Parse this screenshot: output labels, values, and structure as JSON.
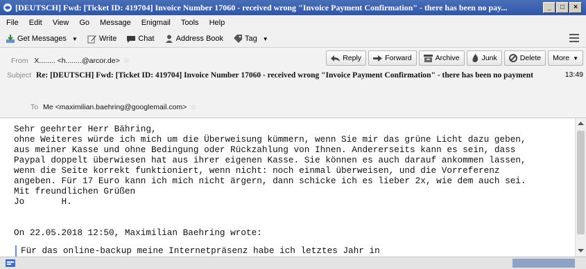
{
  "window": {
    "title": "[DEUTSCH] Fwd: [Ticket ID: 419704] Invoice Number 17060 - received wrong \"Invoice Payment Confirmation\" - there has been no pay...",
    "buttons": [
      "_",
      "□",
      "×"
    ]
  },
  "menu": {
    "items": [
      "File",
      "Edit",
      "View",
      "Go",
      "Message",
      "Enigmail",
      "Tools",
      "Help"
    ]
  },
  "toolbar": {
    "get_messages": "Get Messages",
    "write": "Write",
    "chat": "Chat",
    "address_book": "Address Book",
    "tag": "Tag"
  },
  "header": {
    "from_label": "From",
    "from_value": "X........ <h........@arcor.de>",
    "subject_label": "Subject",
    "subject_value": "Re: [DEUTSCH] Fwd: [Ticket ID: 419704] Invoice Number 17060 - received wrong \"Invoice Payment Confirmation\" - there has been no payment",
    "time": "13:49",
    "to_label": "To",
    "to_value": "Me <maximilian.baehring@googlemail.com>",
    "actions": {
      "reply": "Reply",
      "forward": "Forward",
      "archive": "Archive",
      "junk": "Junk",
      "delete": "Delete",
      "more": "More"
    }
  },
  "body": {
    "lines": [
      "Sehr geehrter Herr Bähring,",
      "ohne Weiteres würde ich mich um die Überweisung kümmern, wenn Sie mir das grüne Licht dazu geben,",
      "aus meiner Kasse und ohne Bedingung oder Rückzahlung von Ihnen. Andererseits kann es sein, dass",
      "Paypal doppelt überwiesen hat aus ihrer eigenen Kasse. Sie können es auch darauf ankommen lassen,",
      "wenn die Seite korrekt funktioniert, wenn nicht: noch einmal überweisen, und die Vorreferenz",
      "angeben. Für 17 Euro kann ich mich nicht ärgern, dann schicke ich es lieber 2x, wie dem auch sei.",
      "Mit freundlichen Grüßen",
      "Jo       H.  ",
      "",
      "On 22.05.2018 12:50, Maximilian Baehring wrote:",
      "Für das online-backup meine Internetpräsenz habe ich letztes Jahr in"
    ]
  }
}
